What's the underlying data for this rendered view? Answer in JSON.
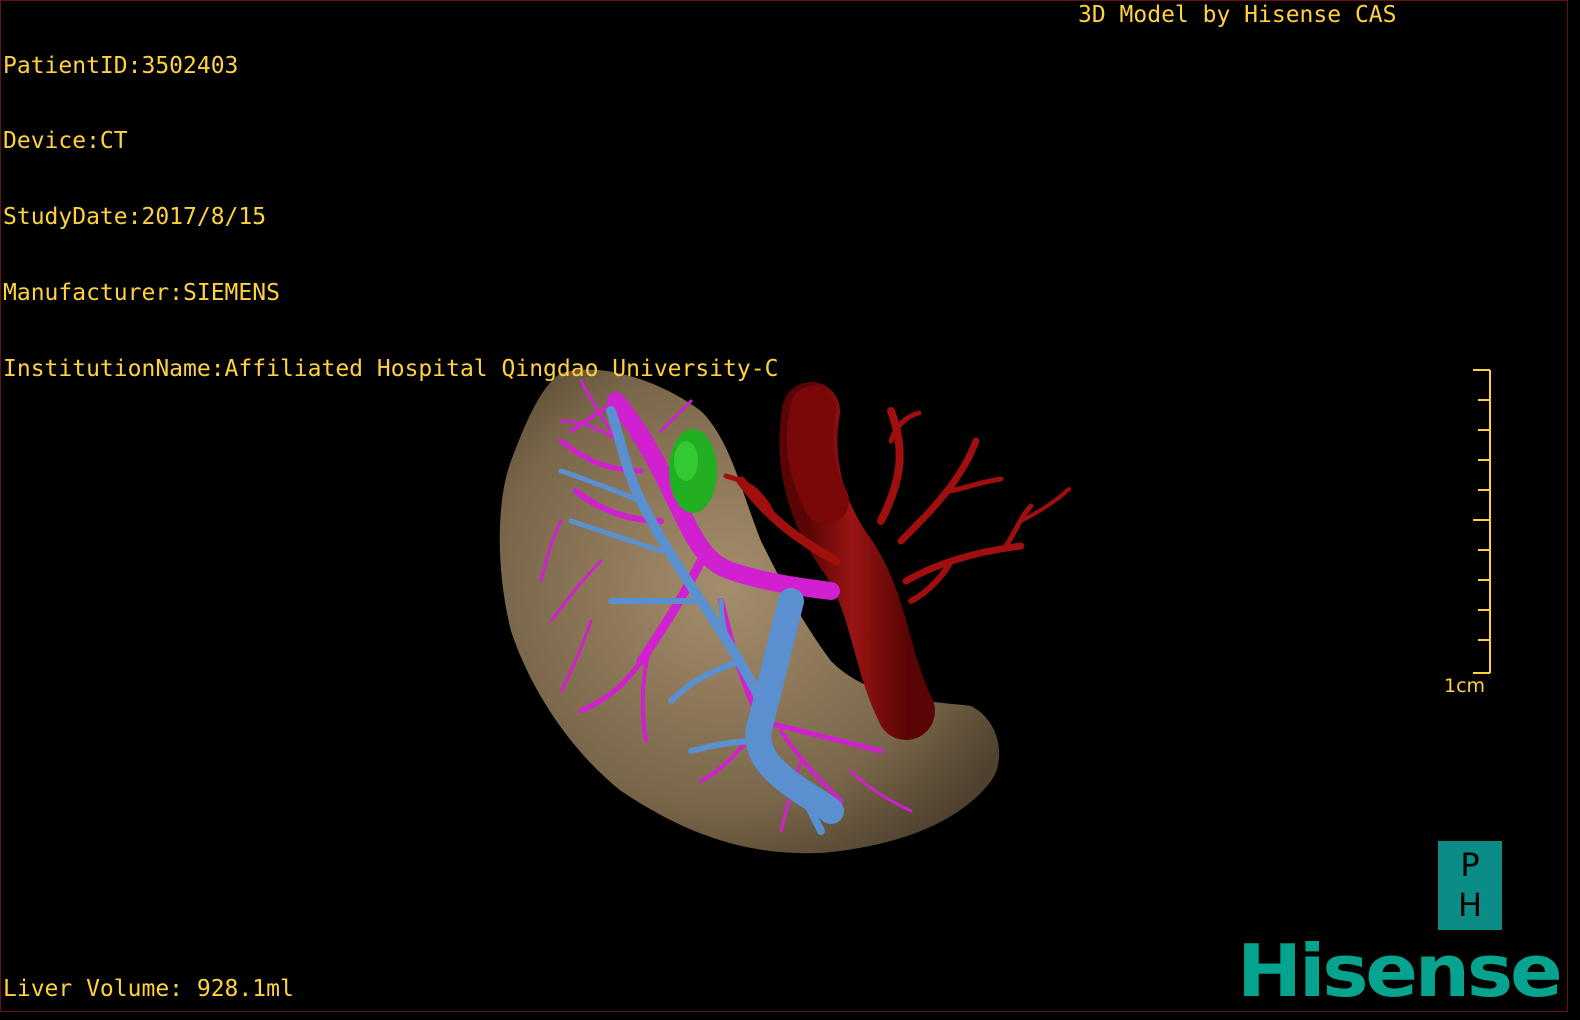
{
  "header": {
    "patient_id": "PatientID:3502403",
    "device": "Device:CT",
    "study_date": "StudyDate:2017/8/15",
    "manufacturer": "Manufacturer:SIEMENS",
    "institution": "InstitutionName:Affiliated Hospital Qingdao University-C",
    "model_credit": "3D Model by Hisense CAS"
  },
  "footer": {
    "liver_volume": "Liver Volume: 928.1ml"
  },
  "scale_bar": {
    "label": "1cm"
  },
  "orientation": {
    "top": "P",
    "bottom": "H"
  },
  "brand": {
    "name": "Hisense"
  },
  "colors": {
    "overlay_text": "#ffd23c",
    "liver": "#a08a68",
    "portal_vein": "#d020d0",
    "hepatic_vein": "#5a8fd0",
    "artery": "#8a0a0a",
    "lesion": "#22b022",
    "brand": "#06a38f"
  }
}
